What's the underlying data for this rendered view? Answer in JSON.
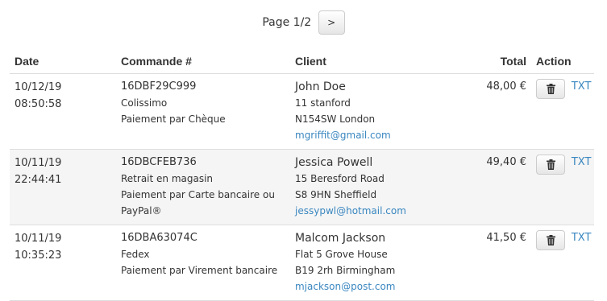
{
  "pagination": {
    "label": "Page 1/2",
    "next_label": ">"
  },
  "columns": {
    "date": "Date",
    "order": "Commande #",
    "client": "Client",
    "total": "Total",
    "action": "Action"
  },
  "orders": [
    {
      "date": "10/12/19",
      "time": "08:50:58",
      "ref": "16DBF29C999",
      "shipping": "Colissimo",
      "payment": "Paiement par Chèque",
      "client_name": "John Doe",
      "address1": "11 stanford",
      "address2": "N154SW London",
      "email": "mgriffit@gmail.com",
      "total": "48,00 €",
      "export_label": "TXT"
    },
    {
      "date": "10/11/19",
      "time": "22:44:41",
      "ref": "16DBCFEB736",
      "shipping": "Retrait en magasin",
      "payment": "Paiement par Carte bancaire ou PayPal®",
      "client_name": "Jessica Powell",
      "address1": "15 Beresford Road",
      "address2": "S8 9HN Sheffield",
      "email": "jessypwl@hotmail.com",
      "total": "49,40 €",
      "export_label": "TXT"
    },
    {
      "date": "10/11/19",
      "time": "10:35:23",
      "ref": "16DBA63074C",
      "shipping": "Fedex",
      "payment": "Paiement par Virement bancaire",
      "client_name": "Malcom Jackson",
      "address1": "Flat 5 Grove House",
      "address2": "B19 2rh Birmingham",
      "email": "mjackson@post.com",
      "total": "41,50 €",
      "export_label": "TXT"
    }
  ],
  "colors": {
    "link": "#3a87c0",
    "row_alt_bg": "#f5f5f5",
    "border": "#dddddd"
  },
  "icons": {
    "delete": "trash-icon"
  }
}
